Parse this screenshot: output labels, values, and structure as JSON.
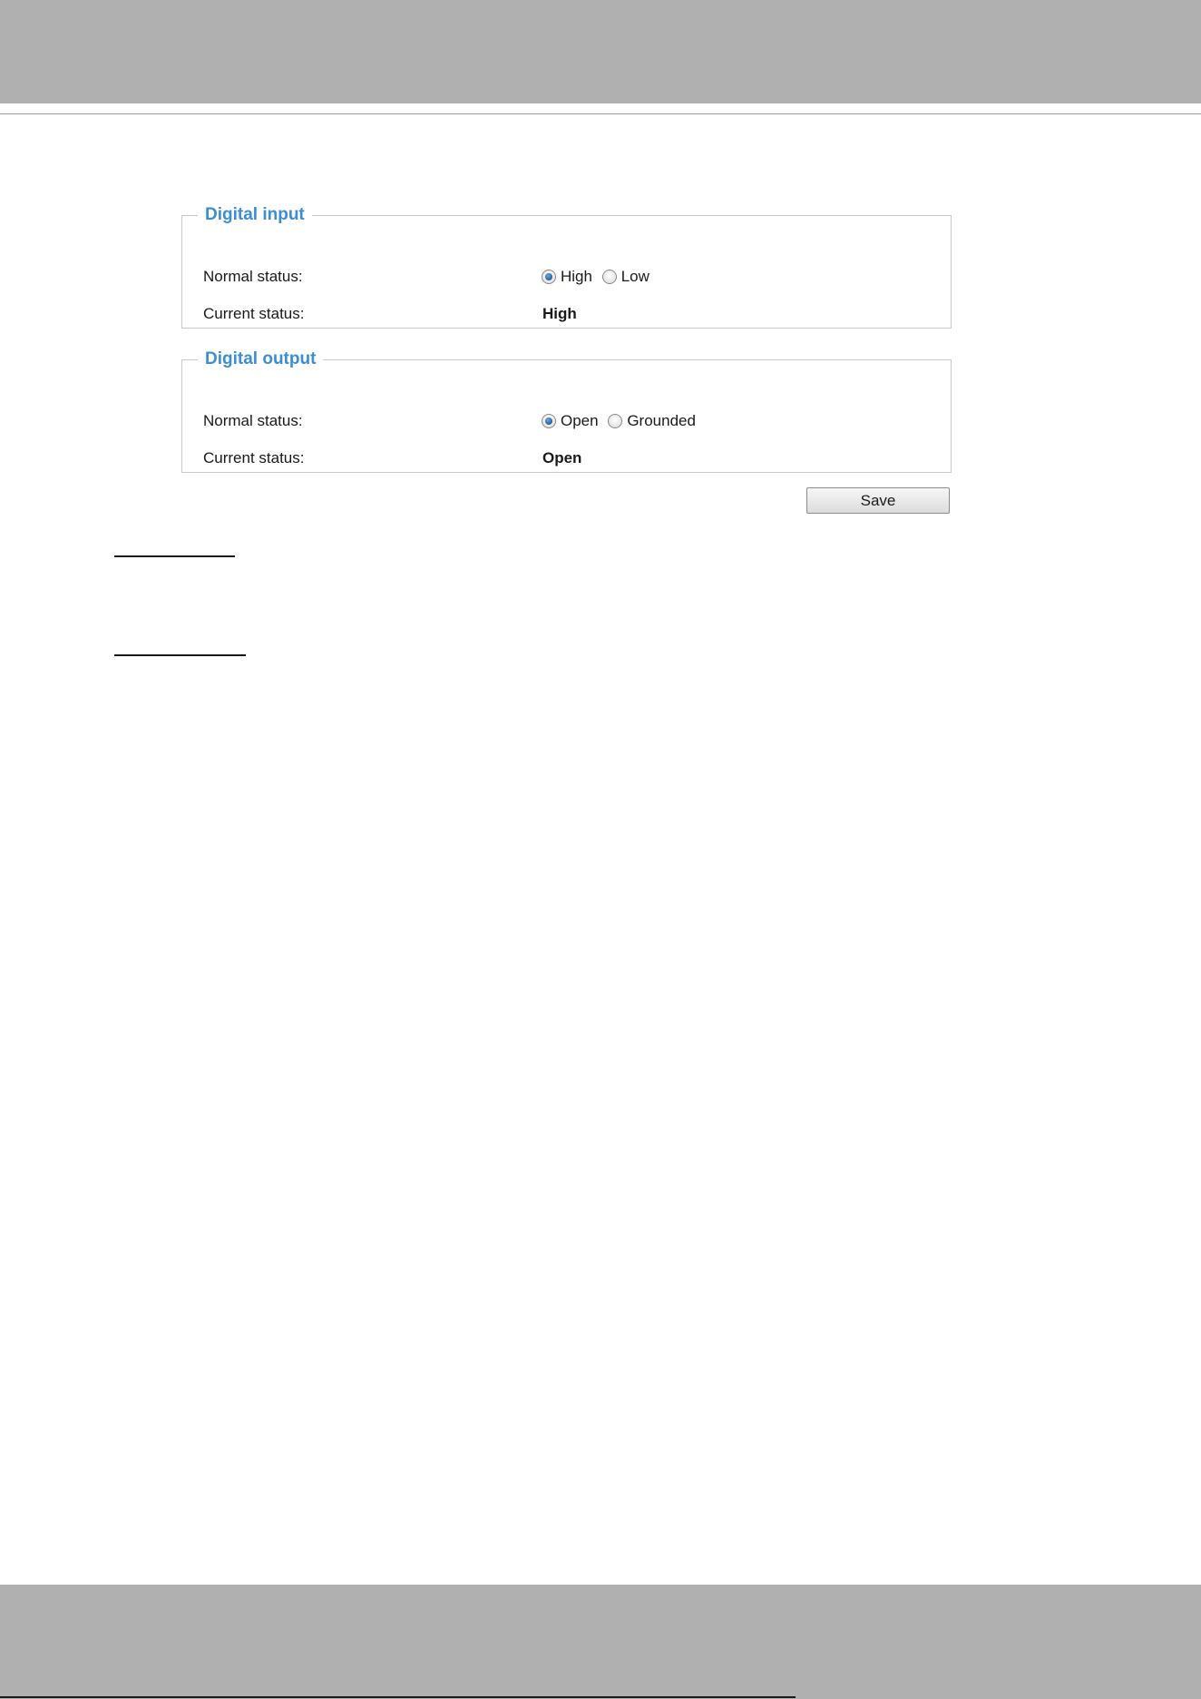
{
  "digital_input": {
    "legend": "Digital input",
    "normal_status_label": "Normal status:",
    "options": [
      {
        "label": "High",
        "selected": true
      },
      {
        "label": "Low",
        "selected": false
      }
    ],
    "current_status_label": "Current status:",
    "current_status_value": "High"
  },
  "digital_output": {
    "legend": "Digital output",
    "normal_status_label": "Normal status:",
    "options": [
      {
        "label": "Open",
        "selected": true
      },
      {
        "label": "Grounded",
        "selected": false
      }
    ],
    "current_status_label": "Current status:",
    "current_status_value": "Open"
  },
  "save_label": "Save",
  "colors": {
    "legend": "#3b8ed4",
    "header_band": "#b0b0b0",
    "radio_selected": "#1f5f9f"
  }
}
